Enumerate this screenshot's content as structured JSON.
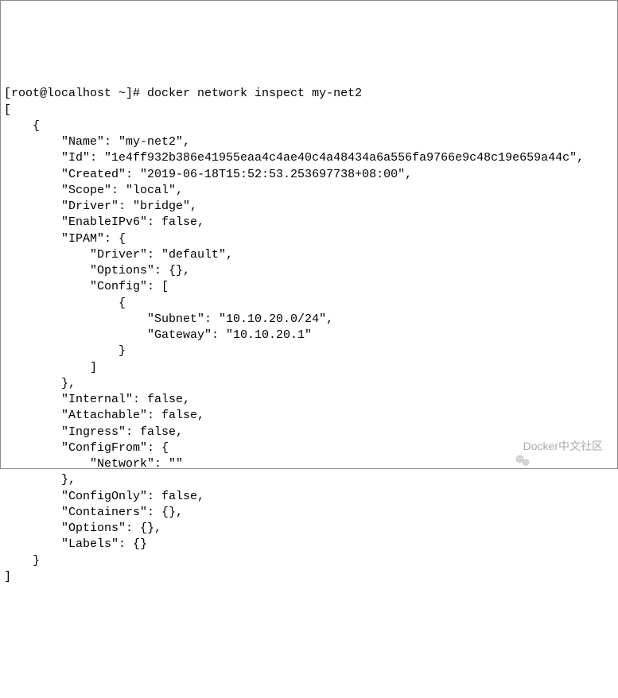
{
  "prompt": "[root@localhost ~]# docker network inspect my-net2",
  "output": {
    "open_bracket": "[",
    "open_brace": "    {",
    "name_line": "        \"Name\": \"my-net2\",",
    "id_line": "        \"Id\": \"1e4ff932b386e41955eaa4c4ae40c4a48434a6a556fa9766e9c48c19e659a44c\",",
    "created_line": "        \"Created\": \"2019-06-18T15:52:53.253697738+08:00\",",
    "scope_line": "        \"Scope\": \"local\",",
    "driver_line": "        \"Driver\": \"bridge\",",
    "enableipv6_line": "        \"EnableIPv6\": false,",
    "ipam_line": "        \"IPAM\": {",
    "ipam_driver_line": "            \"Driver\": \"default\",",
    "ipam_options_line": "            \"Options\": {},",
    "ipam_config_line": "            \"Config\": [",
    "ipam_config_open": "                {",
    "subnet_line": "                    \"Subnet\": \"10.10.20.0/24\",",
    "gateway_line": "                    \"Gateway\": \"10.10.20.1\"",
    "ipam_config_close": "                }",
    "ipam_config_arr_close": "            ]",
    "ipam_close": "        },",
    "internal_line": "        \"Internal\": false,",
    "attachable_line": "        \"Attachable\": false,",
    "ingress_line": "        \"Ingress\": false,",
    "configfrom_line": "        \"ConfigFrom\": {",
    "configfrom_network_line": "            \"Network\": \"\"",
    "configfrom_close": "        },",
    "configonly_line": "        \"ConfigOnly\": false,",
    "containers_line": "        \"Containers\": {},",
    "options_line": "        \"Options\": {},",
    "labels_line": "        \"Labels\": {}",
    "close_brace": "    }",
    "close_bracket": "]"
  },
  "watermark": "Docker中文社区"
}
